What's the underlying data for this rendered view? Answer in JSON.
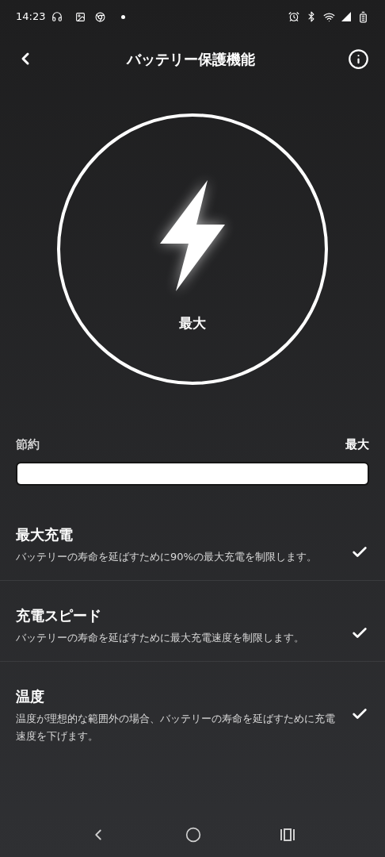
{
  "status_bar": {
    "time": "14:23"
  },
  "header": {
    "title": "バッテリー保護機能"
  },
  "gauge": {
    "label": "最大"
  },
  "slider": {
    "min_label": "節約",
    "max_label": "最大",
    "level": 1.0
  },
  "options": [
    {
      "title": "最大充電",
      "description": "バッテリーの寿命を延ばすために90%の最大充電を制限します。",
      "checked": true
    },
    {
      "title": "充電スピード",
      "description": "バッテリーの寿命を延ばすために最大充電速度を制限します。",
      "checked": true
    },
    {
      "title": "温度",
      "description": "温度が理想的な範囲外の場合、バッテリーの寿命を延ばすために充電速度を下げます。",
      "checked": true
    }
  ]
}
